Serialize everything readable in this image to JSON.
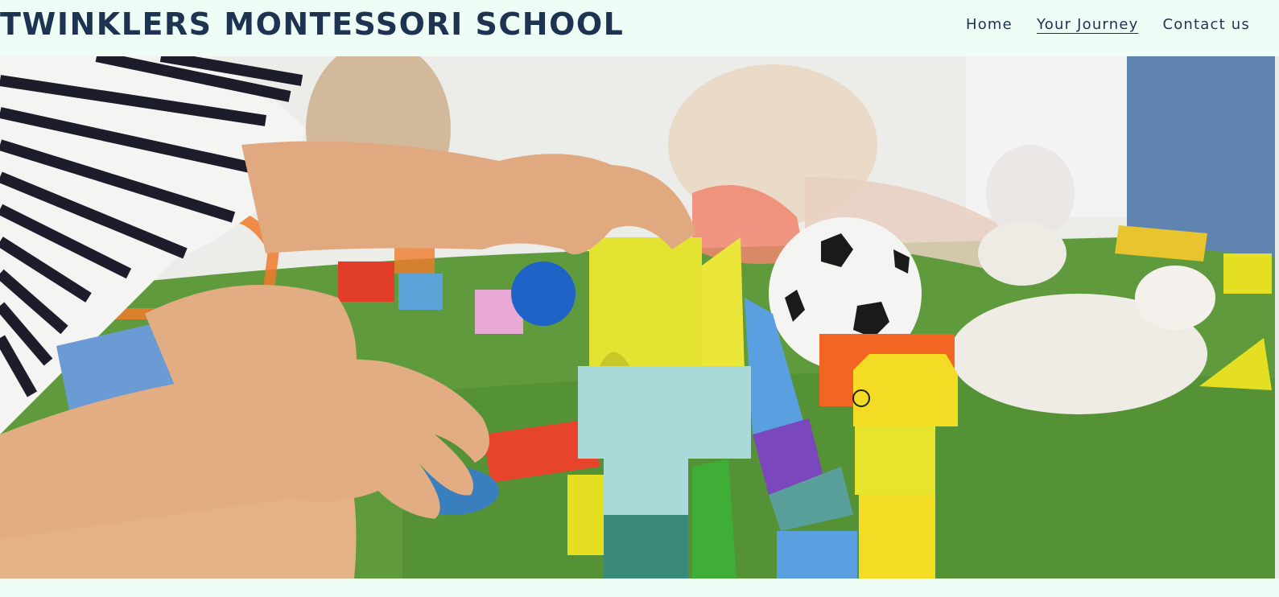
{
  "site": {
    "title": "TWINKLERS MONTESSORI SCHOOL"
  },
  "nav": {
    "items": [
      {
        "label": "Home",
        "active": false
      },
      {
        "label": "Your Journey",
        "active": true
      },
      {
        "label": "Contact us",
        "active": false
      }
    ]
  },
  "colors": {
    "background": "#effdf7",
    "text": "#1e3352"
  }
}
